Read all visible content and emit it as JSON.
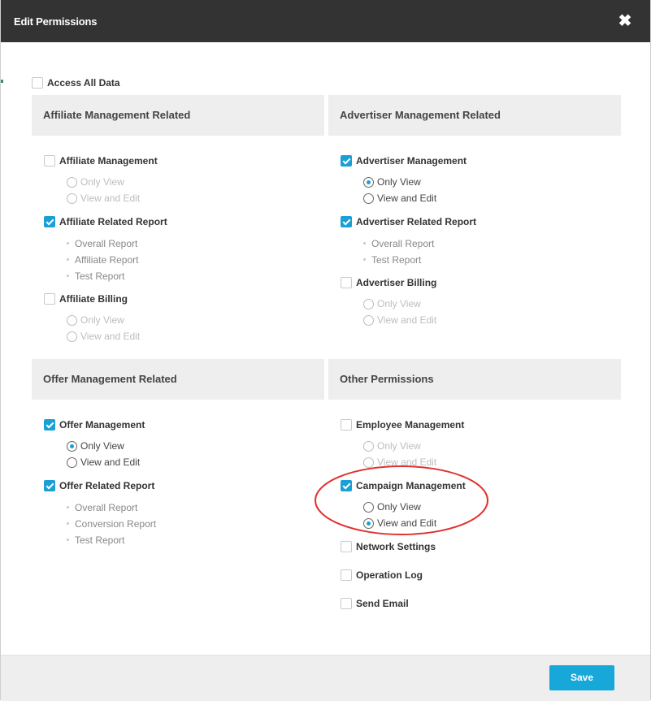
{
  "dialog": {
    "title": "Edit Permissions",
    "close_glyph": "✖",
    "save_label": "Save"
  },
  "access_all": {
    "label": "Access All Data",
    "checked": false
  },
  "sections": [
    {
      "title": "Affiliate Management Related",
      "items": [
        {
          "label": "Affiliate Management",
          "checked": false,
          "radios": [
            {
              "label": "Only View",
              "selected": false
            },
            {
              "label": "View and Edit",
              "selected": false
            }
          ]
        },
        {
          "label": "Affiliate Related Report",
          "checked": true,
          "reports": [
            "Overall Report",
            "Affiliate Report",
            "Test Report"
          ]
        },
        {
          "label": "Affiliate Billing",
          "checked": false,
          "radios": [
            {
              "label": "Only View",
              "selected": false
            },
            {
              "label": "View and Edit",
              "selected": false
            }
          ]
        }
      ]
    },
    {
      "title": "Advertiser Management Related",
      "items": [
        {
          "label": "Advertiser Management",
          "checked": true,
          "radios": [
            {
              "label": "Only View",
              "selected": true
            },
            {
              "label": "View and Edit",
              "selected": false
            }
          ]
        },
        {
          "label": "Advertiser Related Report",
          "checked": true,
          "reports": [
            "Overall Report",
            "Test Report"
          ]
        },
        {
          "label": "Advertiser Billing",
          "checked": false,
          "radios": [
            {
              "label": "Only View",
              "selected": false
            },
            {
              "label": "View and Edit",
              "selected": false
            }
          ]
        }
      ]
    },
    {
      "title": "Offer Management Related",
      "items": [
        {
          "label": "Offer Management",
          "checked": true,
          "radios": [
            {
              "label": "Only View",
              "selected": true
            },
            {
              "label": "View and Edit",
              "selected": false
            }
          ]
        },
        {
          "label": "Offer Related Report",
          "checked": true,
          "reports": [
            "Overall Report",
            "Conversion Report",
            "Test Report"
          ]
        }
      ]
    },
    {
      "title": "Other Permissions",
      "items": [
        {
          "label": "Employee Management",
          "checked": false,
          "radios": [
            {
              "label": "Only View",
              "selected": false
            },
            {
              "label": "View and Edit",
              "selected": false
            }
          ]
        },
        {
          "label": "Campaign Management",
          "checked": true,
          "radios": [
            {
              "label": "Only View",
              "selected": false
            },
            {
              "label": "View and Edit",
              "selected": true
            }
          ]
        },
        {
          "label": "Network Settings",
          "checked": false
        },
        {
          "label": "Operation Log",
          "checked": false
        },
        {
          "label": "Send Email",
          "checked": false
        }
      ]
    }
  ],
  "colors": {
    "header_bg": "#333333",
    "accent": "#1aa0d6",
    "save_button": "#17a7d9",
    "section_bg": "#eeeeee",
    "annotation": "#e0312f"
  }
}
